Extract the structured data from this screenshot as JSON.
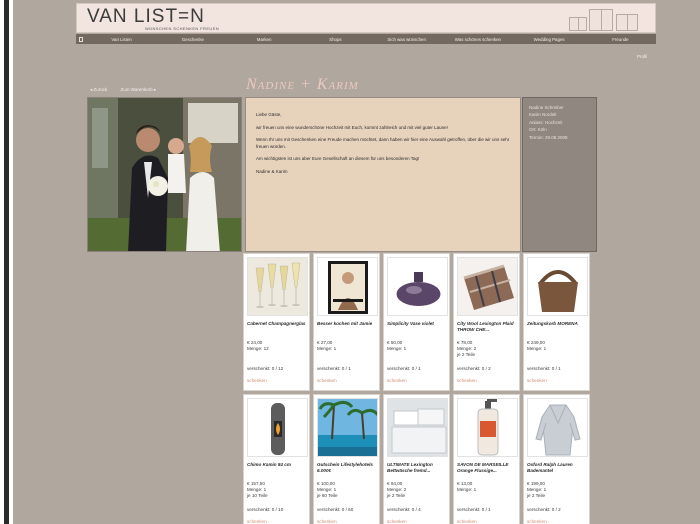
{
  "brand": {
    "logo": "VAN LIST=N",
    "tagline": "WÜNSCHEN SCHENKEN FREUEN"
  },
  "nav": {
    "items": [
      "Van Listen",
      "Geschenke",
      "Marken",
      "Shops",
      "Sich was wünschen",
      "Was schönes schenken",
      "Wedding Pages",
      "Freunde"
    ]
  },
  "profil": "Profil",
  "back": {
    "back_label": "Zurück",
    "cart_label": "Zum Warenkorb"
  },
  "couple": "Nadine + Karim",
  "message": {
    "greeting": "Liebe Gäste,",
    "p1": "wir freuen uns eine wunderschöne Hochzeit mit Euch, kommt zahlreich und mit viel guter Laune!",
    "p2": "Wenn Ihr uns mit Geschenken eine Freude machen möchtet, dann haben wir hier eine Auswahl getroffen, über die wir uns sehr freuen würden.",
    "p3": "Am wichtigsten ist uns aber Eure Gesellschaft an diesem für uns besonderen Tag!",
    "signature": "Nadine & Karim"
  },
  "event": {
    "lines": [
      "Nadine Schreiber",
      "Karim Nordelt",
      "Anlass: Hochzeit",
      "Ort: Köln",
      "Termin: 29.08.2008"
    ]
  },
  "products": [
    {
      "title": "Cabernet Champagnerglas",
      "price": "€ 24,00",
      "qty": "Menge: 12",
      "qty2": "",
      "gifted": "verschenkt: 0 / 12",
      "link": "schenken",
      "icon": "champagne-glasses-icon"
    },
    {
      "title": "Besser kochen mit Jamie",
      "price": "€ 27,00",
      "qty": "Menge: 1",
      "qty2": "",
      "gifted": "verschenkt: 0 / 1",
      "link": "schenken",
      "icon": "cookbook-icon"
    },
    {
      "title": "Simplicity Vase violet",
      "price": "€ 50,00",
      "qty": "Menge: 1",
      "qty2": "",
      "gifted": "verschenkt: 0 / 1",
      "link": "schenken",
      "icon": "vase-icon"
    },
    {
      "title": "City Wool Lexington Plaid THROW CHE...",
      "price": "€ 78,00",
      "qty": "Menge: 2",
      "qty2": "je 2 Teile",
      "gifted": "verschenkt: 0 / 2",
      "link": "schenken",
      "icon": "plaid-blanket-icon"
    },
    {
      "title": "Zeitungskorb MORENA",
      "price": "€ 249,00",
      "qty": "Menge: 1",
      "qty2": "",
      "gifted": "verschenkt: 0 / 1",
      "link": "schenken",
      "icon": "basket-icon"
    },
    {
      "title": "Chimo Kamin 84 cm",
      "price": "€ 157,50",
      "qty": "Menge: 1",
      "qty2": "je 10 Teile",
      "gifted": "verschenkt: 0 / 10",
      "link": "schenken",
      "icon": "fireplace-icon"
    },
    {
      "title": "Gutschein Lifestylehotels 6.000€",
      "price": "€ 100,00",
      "qty": "Menge: 1",
      "qty2": "je 60 Teile",
      "gifted": "verschenkt: 0 / 60",
      "link": "schenken",
      "icon": "beach-voucher-icon"
    },
    {
      "title": "ULTIMATE Lexington Bettwäsche fremd...",
      "price": "€ 94,00",
      "qty": "Menge: 2",
      "qty2": "je 2 Teile",
      "gifted": "verschenkt: 0 / 4",
      "link": "schenken",
      "icon": "bedding-icon"
    },
    {
      "title": "SAVON DE MARSEILLE Orange Flussige...",
      "price": "€ 13,00",
      "qty": "Menge: 1",
      "qty2": "",
      "gifted": "verschenkt: 0 / 1",
      "link": "schenken",
      "icon": "soap-bottle-icon"
    },
    {
      "title": "Oxford Ralph Lauren Bademantel",
      "price": "€ 199,00",
      "qty": "Menge: 1",
      "qty2": "je 2 Teile",
      "gifted": "verschenkt: 0 / 2",
      "link": "schenken",
      "icon": "bathrobe-icon"
    }
  ],
  "colors": {
    "page_bg": "#b0a79f",
    "nav_bg": "#736960",
    "message_bg": "#e7d2bb",
    "accent_title": "#ebc9bf",
    "link": "#d08b6f"
  }
}
